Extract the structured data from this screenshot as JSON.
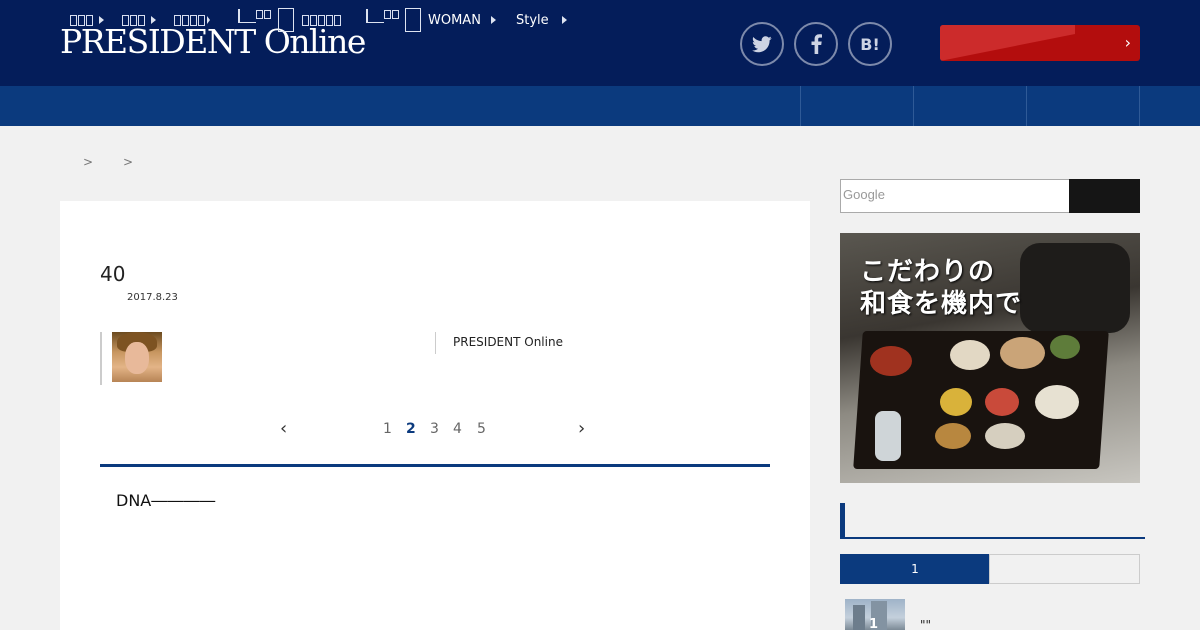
{
  "header": {
    "logo": "PRESIDENT Online",
    "social": [
      "twitter",
      "facebook",
      "hatena-bookmark"
    ],
    "hatena_label": "B!",
    "cta_chevron": "›"
  },
  "nav": {
    "items": [
      {
        "label": "",
        "icon": "tofu-3",
        "arrow": true
      },
      {
        "label": "",
        "icon": "tofu-3",
        "arrow": true
      },
      {
        "label": "",
        "icon": "tofu-4",
        "arrow": true
      },
      {
        "label": "",
        "icon": "book-icon",
        "arrow": false
      },
      {
        "label": "",
        "icon": "tofu-5",
        "arrow": false
      },
      {
        "label": "",
        "icon": "book-icon",
        "arrow": false
      },
      {
        "label": "WOMAN",
        "icon": "book-icon",
        "arrow": true
      },
      {
        "label": "Style",
        "icon": "",
        "arrow": true
      }
    ]
  },
  "breadcrumb": {
    "sep1": ">",
    "sep2": ">"
  },
  "article": {
    "title": "40",
    "date": "2017.8.23",
    "credit": "PRESIDENT Online",
    "lead": "DNA――――"
  },
  "pagination": {
    "prev": "‹",
    "next": "›",
    "pages": [
      "1",
      "2",
      "3",
      "4",
      "5"
    ],
    "current": "2"
  },
  "sidebar": {
    "search_placeholder": "Google",
    "ad": {
      "line1": "こだわりの",
      "line2": "和食を機内で"
    },
    "ranking": {
      "tab_active": "1",
      "item_rank": "1",
      "item_title": "\"\""
    }
  },
  "colors": {
    "navy": "#041d5a",
    "nav": "#0b3a7e",
    "cta": "#b30d0d"
  }
}
